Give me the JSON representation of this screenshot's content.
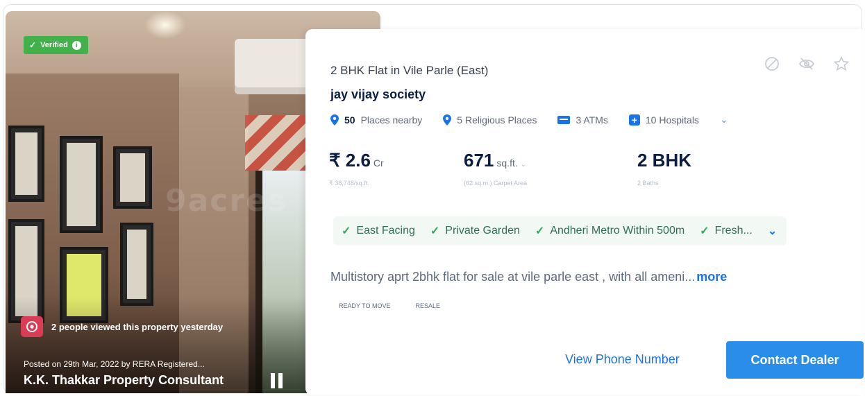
{
  "photo": {
    "verified_label": "Verified",
    "viewed_text": "2 people viewed this property yesterday",
    "posted_line": "Posted on 29th Mar, 2022 by RERA Registered...",
    "dealer_name": "K.K. Thakkar Property Consultant",
    "watermark": "9acres"
  },
  "listing": {
    "title": "2 BHK Flat in Vile Parle (East)",
    "society": "jay vijay society",
    "amenities": [
      {
        "count": "50",
        "label": "Places nearby",
        "icon": "pin-icon"
      },
      {
        "label": "5 Religious Places",
        "icon": "pin-icon"
      },
      {
        "label": "3 ATMs",
        "icon": "atm-icon"
      },
      {
        "label": "10 Hospitals",
        "icon": "hospital-icon"
      }
    ],
    "price": {
      "value": "₹ 2.6",
      "unit": "Cr",
      "sub": "₹ 38,748/sq.ft."
    },
    "area": {
      "value": "671",
      "unit": "sq.ft.",
      "sub": "(62 sq.m.) Carpet Area"
    },
    "bhk": {
      "value": "2 BHK",
      "sub": "2 Baths"
    },
    "tags": [
      "East Facing",
      "Private Garden",
      "Andheri Metro Within 500m",
      "Fresh..."
    ],
    "description": "Multistory aprt 2bhk flat for sale at vile parle east , with all ameni...",
    "more_label": "more",
    "chips": [
      "READY TO MOVE",
      "RESALE"
    ]
  },
  "actions": {
    "view_phone": "View Phone Number",
    "contact": "Contact Dealer"
  },
  "colors": {
    "accent": "#2a8de9",
    "verified": "#42b14a",
    "eye_badge": "#d93c54"
  }
}
